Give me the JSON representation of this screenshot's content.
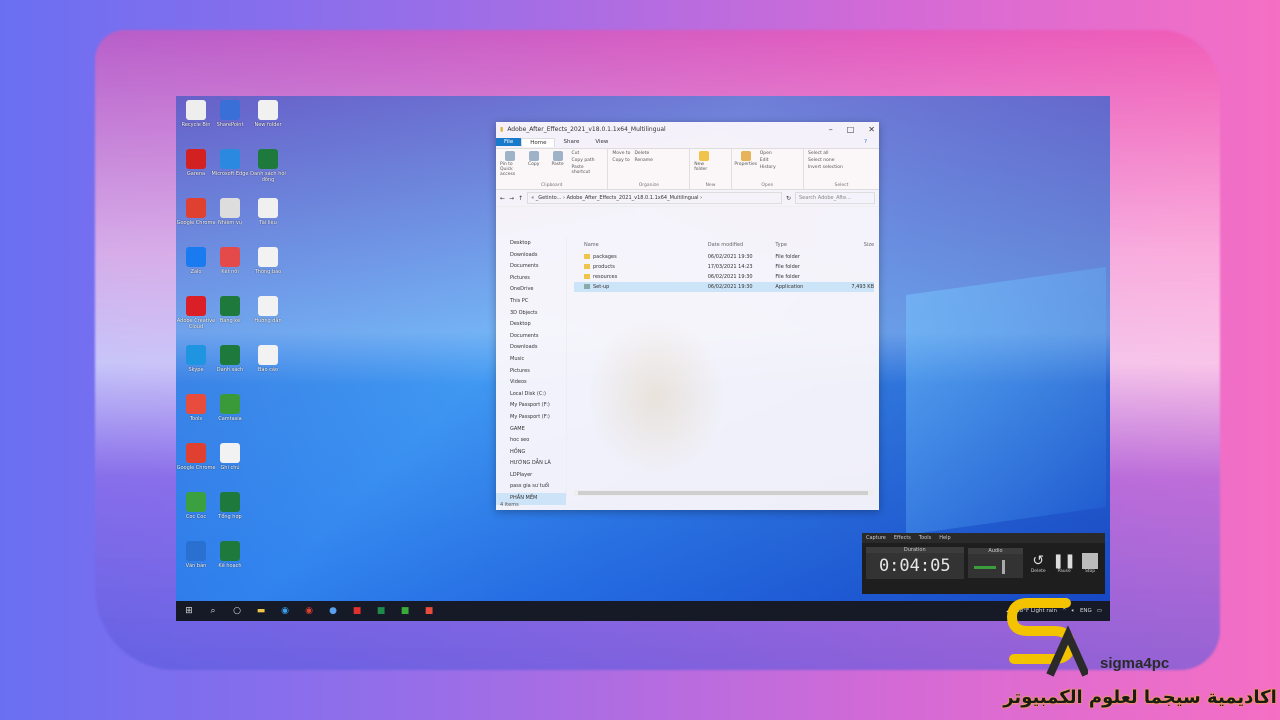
{
  "desktop": {
    "icons": [
      {
        "label": "Recycle Bin",
        "color": "#eeeeee"
      },
      {
        "label": "SharePoint",
        "color": "#3a6fd8"
      },
      {
        "label": "New folder",
        "color": "#f1f1f1"
      },
      {
        "label": "Garena",
        "color": "#d32020"
      },
      {
        "label": "Microsoft Edge",
        "color": "#2b8ae0"
      },
      {
        "label": "Danh sách hội đồng",
        "color": "#1e7a3c"
      },
      {
        "label": "Google Chrome",
        "color": "#e04030"
      },
      {
        "label": "Nhiệm vụ",
        "color": "#dddddd"
      },
      {
        "label": "Tài liệu",
        "color": "#f0f0f0"
      },
      {
        "label": "Zalo",
        "color": "#1a7af0"
      },
      {
        "label": "Kết nối",
        "color": "#e54a4a"
      },
      {
        "label": "Thông báo",
        "color": "#f2f2f2"
      },
      {
        "label": "Adobe Creative Cloud",
        "color": "#da1f26"
      },
      {
        "label": "Bảng kê",
        "color": "#1e7a3c"
      },
      {
        "label": "Hướng dẫn",
        "color": "#f2f2f2"
      },
      {
        "label": "Skype",
        "color": "#1f94e0"
      },
      {
        "label": "Danh sách",
        "color": "#1e7a3c"
      },
      {
        "label": "Báo cáo",
        "color": "#f2f2f2"
      },
      {
        "label": "Tools",
        "color": "#e84c3d"
      },
      {
        "label": "Camtasia",
        "color": "#3a9a3a"
      },
      {
        "label": "Google Chrome",
        "color": "#e04030"
      },
      {
        "label": "Ghi chú",
        "color": "#f2f2f2"
      },
      {
        "label": "Coc Coc",
        "color": "#3aa040"
      },
      {
        "label": "Tổng hợp",
        "color": "#1e7a3c"
      },
      {
        "label": "Văn bản",
        "color": "#2a70d0"
      },
      {
        "label": "Kế hoạch",
        "color": "#1e7a3c"
      }
    ]
  },
  "explorer": {
    "title": "Adobe_After_Effects_2021_v18.0.1.1x64_Multilingual",
    "tabs": [
      "File",
      "Home",
      "Share",
      "View"
    ],
    "ribbon": {
      "clipboard": {
        "label": "Clipboard",
        "pin": "Pin to Quick access",
        "copy": "Copy",
        "paste": "Paste",
        "cut": "Cut",
        "copy_path": "Copy path",
        "paste_shortcut": "Paste shortcut"
      },
      "organize": {
        "label": "Organize",
        "move_to": "Move to",
        "copy_to": "Copy to",
        "delete": "Delete",
        "rename": "Rename"
      },
      "new": {
        "label": "New",
        "new_folder": "New folder"
      },
      "open": {
        "label": "Open",
        "properties": "Properties",
        "open": "Open",
        "edit": "Edit",
        "history": "History"
      },
      "select": {
        "label": "Select",
        "select_all": "Select all",
        "select_none": "Select none",
        "invert": "Invert selection"
      }
    },
    "address": "« _Getinto... › Adobe_After_Effects_2021_v18.0.1.1x64_Multilingual ›",
    "search_placeholder": "Search Adobe_Afte...",
    "nav": [
      "Desktop",
      "Downloads",
      "Documents",
      "Pictures",
      "OneDrive",
      "This PC",
      "3D Objects",
      "Desktop",
      "Documents",
      "Downloads",
      "Music",
      "Pictures",
      "Videos",
      "Local Disk (C:)",
      "My Passport (F:)",
      "My Passport (F:)",
      "GAME",
      "hoc seo",
      "HỒNG",
      "HƯỚNG DẪN LÀ",
      "LDPlayer",
      "pass gia sư tuổi",
      "PHẦN MỀM"
    ],
    "columns": [
      "Name",
      "Date modified",
      "Type",
      "Size"
    ],
    "rows": [
      {
        "name": "packages",
        "date": "06/02/2021 19:30",
        "type": "File folder",
        "size": "",
        "kind": "folder"
      },
      {
        "name": "products",
        "date": "17/03/2021 14:23",
        "type": "File folder",
        "size": "",
        "kind": "folder"
      },
      {
        "name": "resources",
        "date": "06/02/2021 19:30",
        "type": "File folder",
        "size": "",
        "kind": "folder"
      },
      {
        "name": "Set-up",
        "date": "06/02/2021 19:30",
        "type": "Application",
        "size": "7,493 KB",
        "kind": "app"
      }
    ],
    "status": "4 items"
  },
  "recorder": {
    "menu": [
      "Capture",
      "Effects",
      "Tools",
      "Help"
    ],
    "duration_label": "Duration",
    "duration": "0:04:05",
    "audio_label": "Audio",
    "delete": "Delete",
    "pause": "Pause",
    "stop": "Stop"
  },
  "taskbar": {
    "weather": "88°F  Light rain",
    "lang": "ENG"
  },
  "logo": {
    "name": "sigma4pc",
    "arabic": "اكاديمية سيجما لعلوم الكمبيوتر",
    "accent": "#f3c300"
  }
}
